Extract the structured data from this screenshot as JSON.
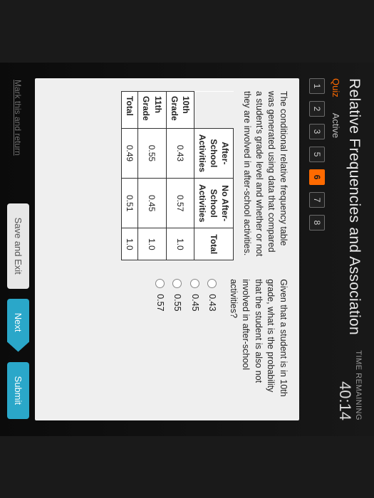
{
  "header": {
    "title": "Relative Frequencies and Association",
    "quiz_label": "Quiz",
    "status": "Active",
    "timer_label": "TIME REMAINING",
    "timer_value": "40:14"
  },
  "questions": {
    "numbers": [
      "1",
      "2",
      "3",
      "5",
      "6",
      "7",
      "8"
    ],
    "current": "6"
  },
  "left": {
    "prompt": "The conditional relative frequency table was generated using data that compared a student's grade level and whether or not they are involved in after-school activities.",
    "table": {
      "col_headers": [
        "After-School Activities",
        "No After-School Activities",
        "Total"
      ],
      "rows": [
        {
          "label": "10th Grade",
          "cells": [
            "0.43",
            "0.57",
            "1.0"
          ]
        },
        {
          "label": "11th Grade",
          "cells": [
            "0.55",
            "0.45",
            "1.0"
          ]
        },
        {
          "label": "Total",
          "cells": [
            "0.49",
            "0.51",
            "1.0"
          ]
        }
      ]
    }
  },
  "right": {
    "question": "Given that a student is in 10th grade, what is the probability that the student is also not involved in after-school activities?",
    "options": [
      "0.43",
      "0.45",
      "0.55",
      "0.57"
    ]
  },
  "footer": {
    "mark": "Mark this and return",
    "save": "Save and Exit",
    "next": "Next",
    "submit": "Submit"
  }
}
